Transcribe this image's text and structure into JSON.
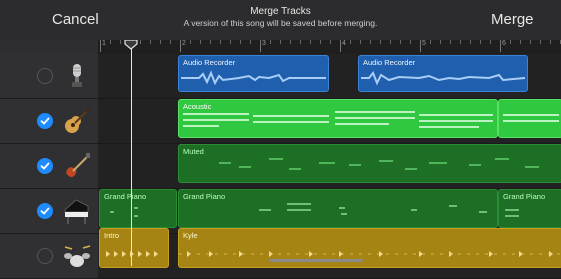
{
  "topbar": {
    "cancel_label": "Cancel",
    "merge_label": "Merge",
    "title": "Merge Tracks",
    "subtitle": "A version of this song will be saved before merging."
  },
  "ruler": {
    "bars": [
      "1",
      "2",
      "3",
      "4",
      "5",
      "6"
    ]
  },
  "tracks": [
    {
      "name": "audio-recorder",
      "icon": "microphone-icon",
      "selected": false
    },
    {
      "name": "acoustic",
      "icon": "acoustic-guitar-icon",
      "selected": true
    },
    {
      "name": "muted",
      "icon": "electric-guitar-icon",
      "selected": true
    },
    {
      "name": "grand-piano",
      "icon": "grand-piano-icon",
      "selected": true
    },
    {
      "name": "drums",
      "icon": "drum-kit-icon",
      "selected": false
    }
  ],
  "regions": {
    "audio1": "Audio Recorder",
    "audio2": "Audio Recorder",
    "acoustic": "Acoustic",
    "muted": "Muted",
    "piano1": "Grand Piano",
    "piano2": "Grand Piano",
    "piano3": "Grand Piano",
    "intro": "Intro",
    "kyle": "Kyle"
  },
  "colors": {
    "checked": "#1e8bff",
    "audio_region": "#1f5fae",
    "midi_selected": "#30c741",
    "midi_region": "#1e6f26",
    "drummer_region": "#a68413"
  }
}
